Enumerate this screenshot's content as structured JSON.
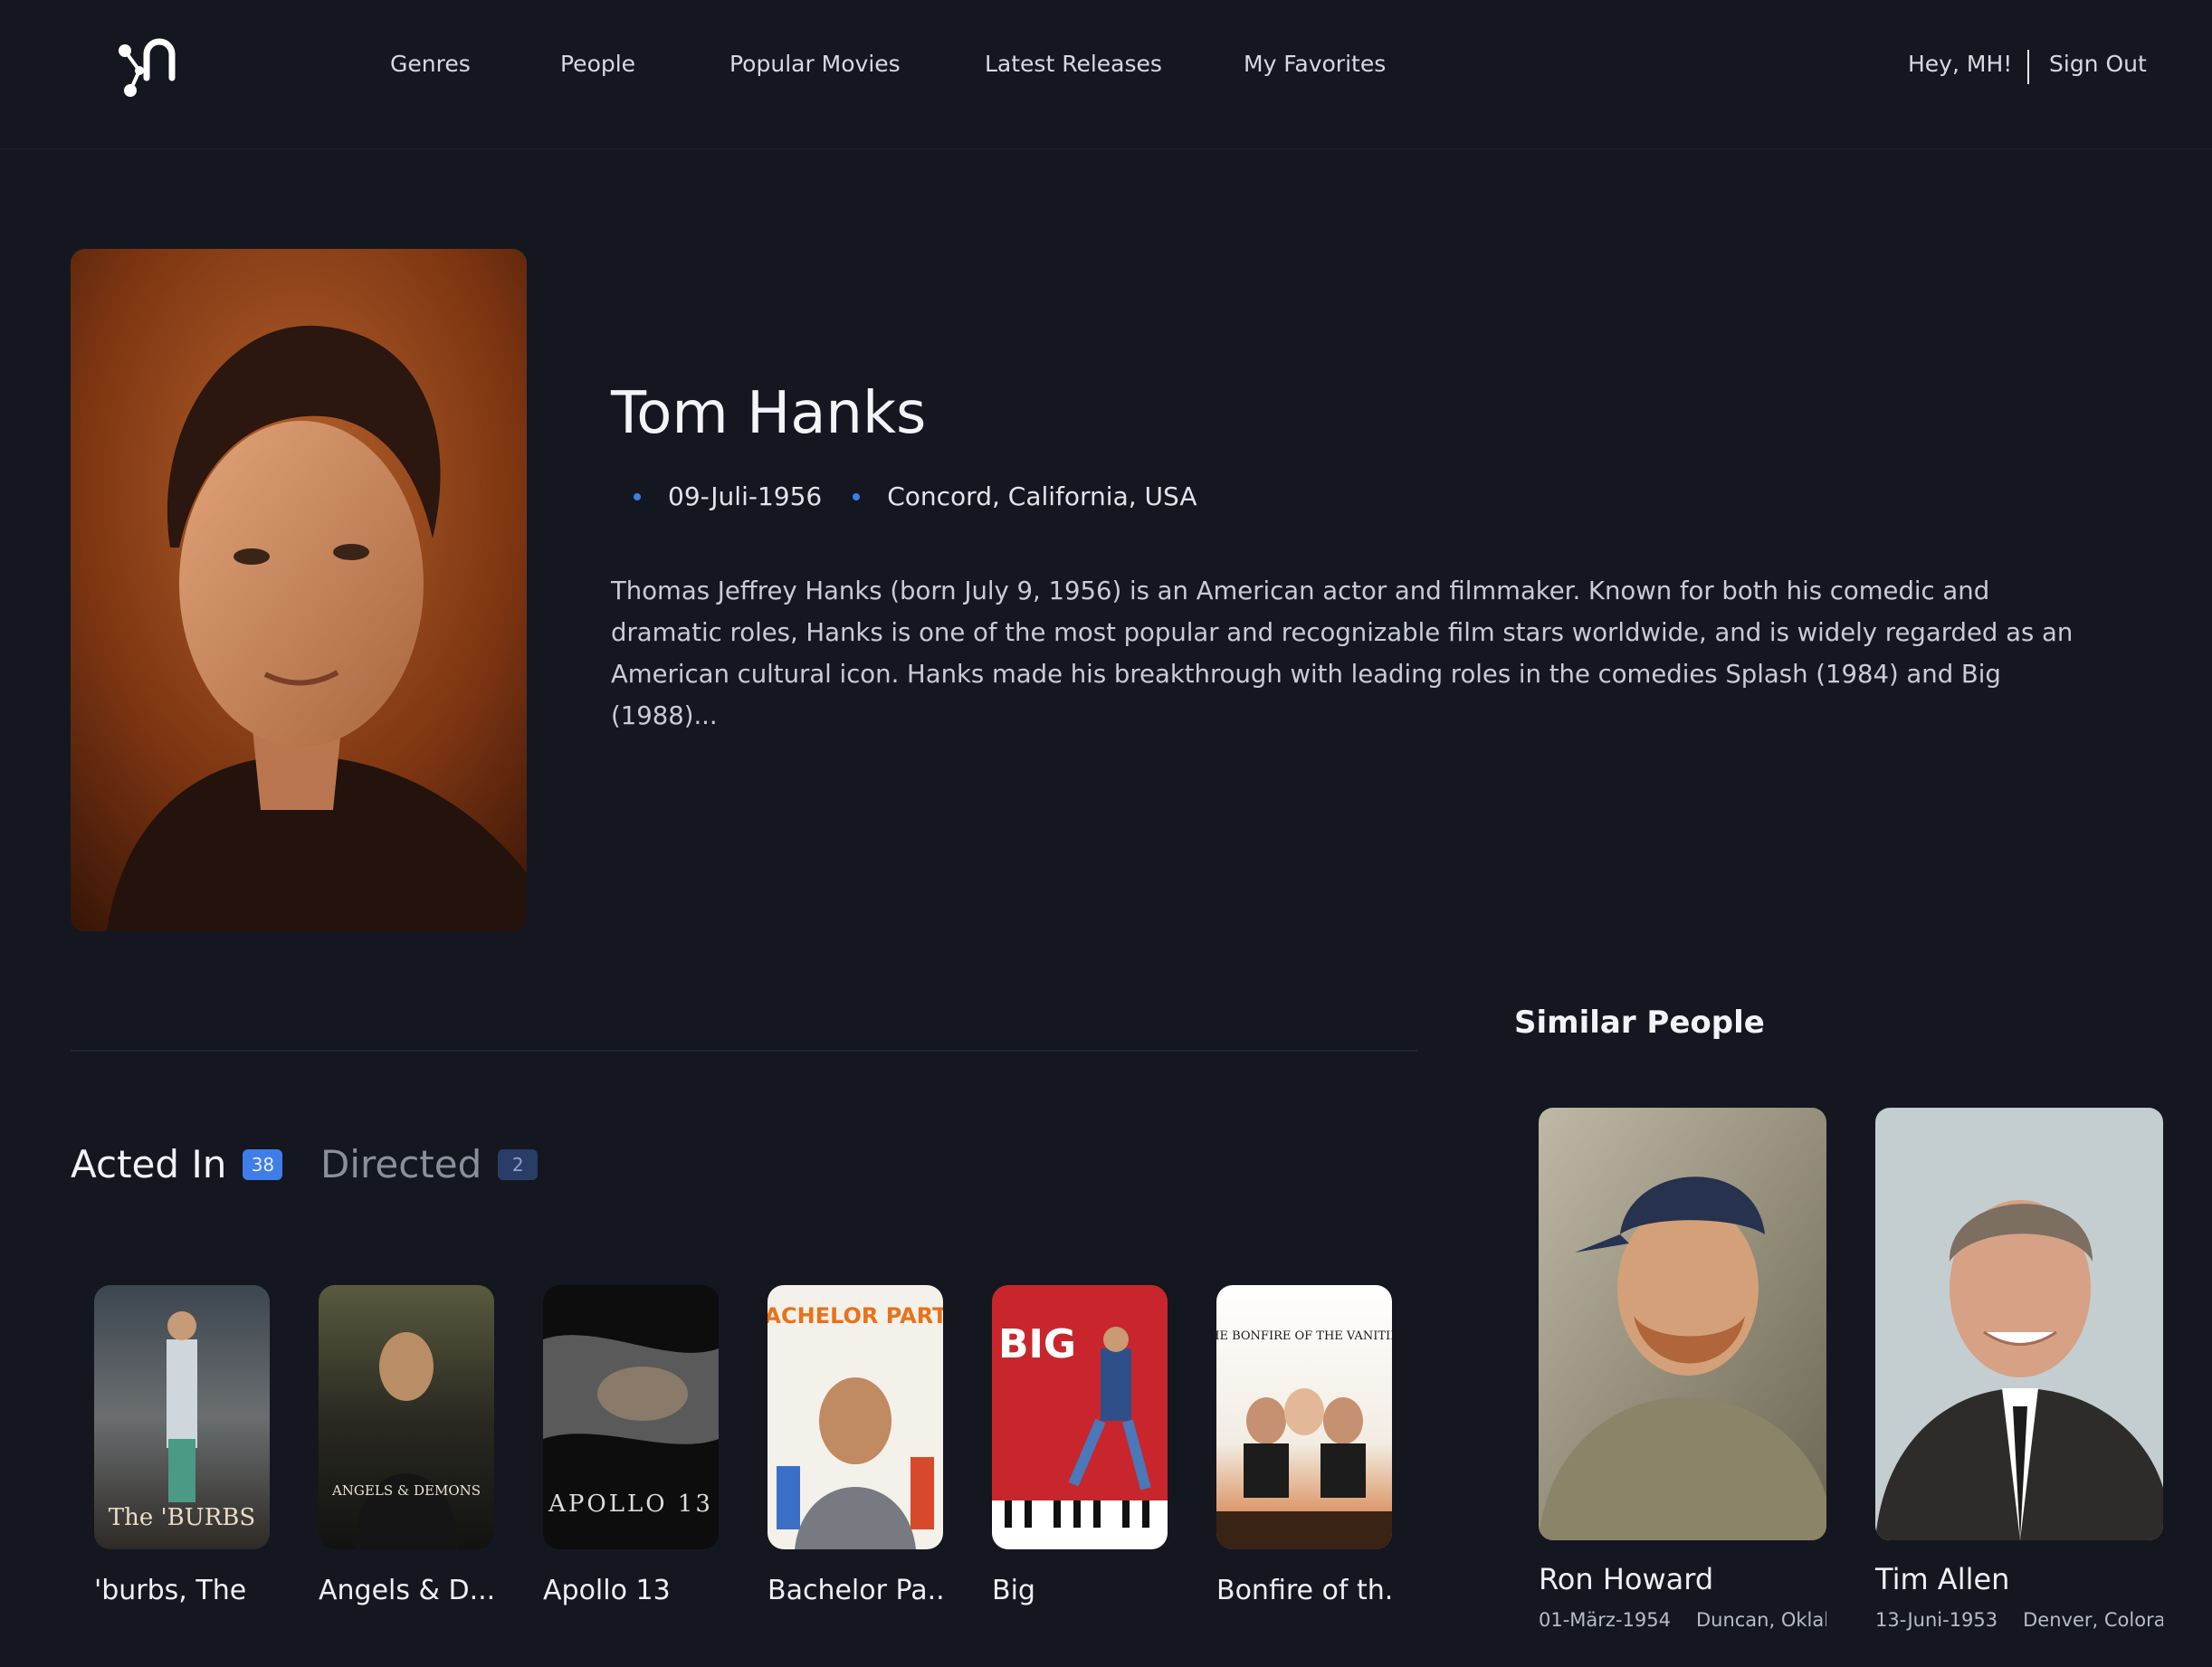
{
  "nav": {
    "items": [
      {
        "label": "Genres"
      },
      {
        "label": "People"
      },
      {
        "label": "Popular Movies"
      },
      {
        "label": "Latest Releases"
      },
      {
        "label": "My Favorites"
      }
    ],
    "greeting": "Hey, MH!",
    "sign_out": "Sign Out"
  },
  "person": {
    "name": "Tom Hanks",
    "birth_date": "09-Juli-1956",
    "birth_place": "Concord, California, USA",
    "bio": "Thomas Jeffrey Hanks (born July 9, 1956) is an American actor and filmmaker. Known for both his comedic and dramatic roles, Hanks is one of the most popular and recognizable film stars worldwide, and is widely regarded as an American cultural icon. Hanks made his breakthrough with leading roles in the comedies Splash (1984) and Big (1988)..."
  },
  "tabs": [
    {
      "label": "Acted In",
      "count": "38"
    },
    {
      "label": "Directed",
      "count": "2"
    }
  ],
  "movies": [
    {
      "title": "'burbs, The",
      "poster_text": "The 'BURBS"
    },
    {
      "title": "Angels & D...",
      "poster_text": "ANGELS & DEMONS"
    },
    {
      "title": "Apollo 13",
      "poster_text": "APOLLO 13"
    },
    {
      "title": "Bachelor Pa...",
      "poster_text": "BACHELOR PARTY"
    },
    {
      "title": "Big",
      "poster_text": "BIG"
    },
    {
      "title": "Bonfire of th...",
      "poster_text": "THE BONFIRE OF THE VANITIES"
    }
  ],
  "similar": {
    "title": "Similar People",
    "people": [
      {
        "name": "Ron Howard",
        "birth_date": "01-März-1954",
        "birth_place": "Duncan, Oklahoma"
      },
      {
        "name": "Tim Allen",
        "birth_date": "13-Juni-1953",
        "birth_place": "Denver, Colorado"
      }
    ]
  },
  "colors": {
    "background": "#141720",
    "accent": "#3f7de8"
  }
}
